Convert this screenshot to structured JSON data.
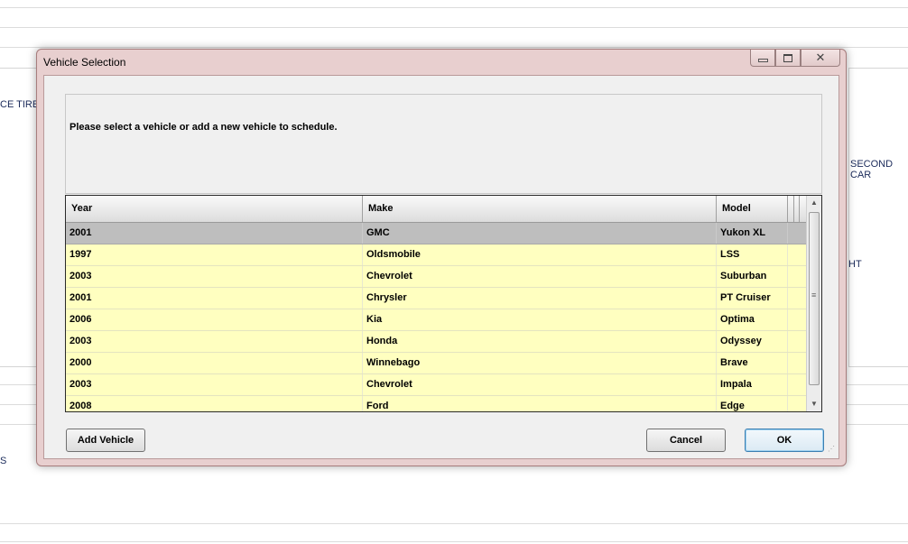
{
  "background": {
    "left_fragment_1": "CE TIRES",
    "left_fragment_2": "S",
    "right_fragment_1": "SECOND CAR",
    "right_fragment_2": "HT"
  },
  "dialog": {
    "title": "Vehicle Selection",
    "message": "Please select a vehicle or add a new vehicle to schedule.",
    "columns": [
      "Year",
      "Make",
      "Model"
    ],
    "rows": [
      {
        "year": "2001",
        "make": "GMC",
        "model": "Yukon XL",
        "selected": true
      },
      {
        "year": "1997",
        "make": "Oldsmobile",
        "model": "LSS",
        "selected": false
      },
      {
        "year": "2003",
        "make": "Chevrolet",
        "model": "Suburban",
        "selected": false
      },
      {
        "year": "2001",
        "make": "Chrysler",
        "model": "PT Cruiser",
        "selected": false
      },
      {
        "year": "2006",
        "make": "Kia",
        "model": "Optima",
        "selected": false
      },
      {
        "year": "2003",
        "make": "Honda",
        "model": "Odyssey",
        "selected": false
      },
      {
        "year": "2000",
        "make": "Winnebago",
        "model": "Brave",
        "selected": false
      },
      {
        "year": "2003",
        "make": "Chevrolet",
        "model": "Impala",
        "selected": false
      },
      {
        "year": "2008",
        "make": "Ford",
        "model": "Edge",
        "selected": false
      }
    ],
    "buttons": {
      "add_vehicle": "Add Vehicle",
      "cancel": "Cancel",
      "ok": "OK"
    },
    "window_controls": {
      "minimize_icon": "minimize-icon",
      "restore_icon": "restore-icon",
      "close_icon": "close-icon"
    }
  },
  "colors": {
    "row_highlight": "#ffffc0",
    "selected_row": "#bebebe",
    "dialog_frame": "#e8cfcf"
  }
}
